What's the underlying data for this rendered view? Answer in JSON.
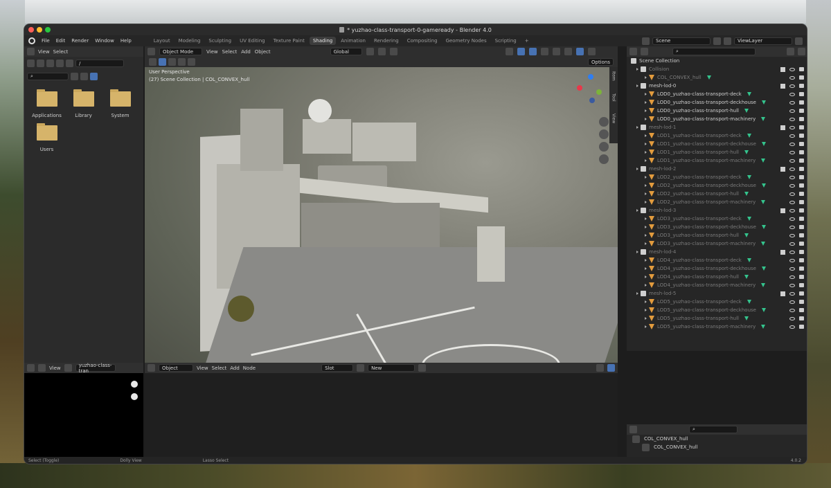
{
  "window": {
    "title": "* yuzhao-class-transport-0-gameready - Blender 4.0"
  },
  "menu": {
    "items": [
      "File",
      "Edit",
      "Render",
      "Window",
      "Help"
    ]
  },
  "workspace_tabs": [
    "Layout",
    "Modeling",
    "Sculpting",
    "UV Editing",
    "Texture Paint",
    "Shading",
    "Animation",
    "Rendering",
    "Compositing",
    "Geometry Nodes",
    "Scripting"
  ],
  "active_tab": "Shading",
  "scene": {
    "label": "Scene",
    "view_layer": "ViewLayer"
  },
  "file_browser": {
    "menu": [
      "View",
      "Select"
    ],
    "path": "/",
    "folders": [
      "Applications",
      "Library",
      "System",
      "Users"
    ]
  },
  "viewport": {
    "mode": "Object Mode",
    "menu": [
      "View",
      "Select",
      "Add",
      "Object"
    ],
    "transform": "Global",
    "options": "Options",
    "perspective": "User Perspective",
    "context": "(27) Scene Collection | COL_CONVEX_hull",
    "side_tabs": [
      "Item",
      "Tool",
      "View"
    ]
  },
  "outliner": {
    "root": "Scene Collection",
    "rows": [
      {
        "label": "Collision",
        "type": "coll",
        "level": 1,
        "dim": true
      },
      {
        "label": "COL_CONVEX_hull",
        "type": "mesh",
        "level": 2,
        "dim": true
      },
      {
        "label": "mesh-lod-0",
        "type": "coll",
        "level": 1,
        "dim": false
      },
      {
        "label": "LOD0_yuzhao-class-transport-deck",
        "type": "mesh",
        "level": 2,
        "dim": false
      },
      {
        "label": "LOD0_yuzhao-class-transport-deckhouse",
        "type": "mesh",
        "level": 2,
        "dim": false
      },
      {
        "label": "LOD0_yuzhao-class-transport-hull",
        "type": "mesh",
        "level": 2,
        "dim": false
      },
      {
        "label": "LOD0_yuzhao-class-transport-machinery",
        "type": "mesh",
        "level": 2,
        "dim": false
      },
      {
        "label": "mesh-lod-1",
        "type": "coll",
        "level": 1,
        "dim": true
      },
      {
        "label": "LOD1_yuzhao-class-transport-deck",
        "type": "mesh",
        "level": 2,
        "dim": true
      },
      {
        "label": "LOD1_yuzhao-class-transport-deckhouse",
        "type": "mesh",
        "level": 2,
        "dim": true
      },
      {
        "label": "LOD1_yuzhao-class-transport-hull",
        "type": "mesh",
        "level": 2,
        "dim": true
      },
      {
        "label": "LOD1_yuzhao-class-transport-machinery",
        "type": "mesh",
        "level": 2,
        "dim": true
      },
      {
        "label": "mesh-lod-2",
        "type": "coll",
        "level": 1,
        "dim": true
      },
      {
        "label": "LOD2_yuzhao-class-transport-deck",
        "type": "mesh",
        "level": 2,
        "dim": true
      },
      {
        "label": "LOD2_yuzhao-class-transport-deckhouse",
        "type": "mesh",
        "level": 2,
        "dim": true
      },
      {
        "label": "LOD2_yuzhao-class-transport-hull",
        "type": "mesh",
        "level": 2,
        "dim": true
      },
      {
        "label": "LOD2_yuzhao-class-transport-machinery",
        "type": "mesh",
        "level": 2,
        "dim": true
      },
      {
        "label": "mesh-lod-3",
        "type": "coll",
        "level": 1,
        "dim": true
      },
      {
        "label": "LOD3_yuzhao-class-transport-deck",
        "type": "mesh",
        "level": 2,
        "dim": true
      },
      {
        "label": "LOD3_yuzhao-class-transport-deckhouse",
        "type": "mesh",
        "level": 2,
        "dim": true
      },
      {
        "label": "LOD3_yuzhao-class-transport-hull",
        "type": "mesh",
        "level": 2,
        "dim": true
      },
      {
        "label": "LOD3_yuzhao-class-transport-machinery",
        "type": "mesh",
        "level": 2,
        "dim": true
      },
      {
        "label": "mesh-lod-4",
        "type": "coll",
        "level": 1,
        "dim": true
      },
      {
        "label": "LOD4_yuzhao-class-transport-deck",
        "type": "mesh",
        "level": 2,
        "dim": true
      },
      {
        "label": "LOD4_yuzhao-class-transport-deckhouse",
        "type": "mesh",
        "level": 2,
        "dim": true
      },
      {
        "label": "LOD4_yuzhao-class-transport-hull",
        "type": "mesh",
        "level": 2,
        "dim": true
      },
      {
        "label": "LOD4_yuzhao-class-transport-machinery",
        "type": "mesh",
        "level": 2,
        "dim": true
      },
      {
        "label": "mesh-lod-5",
        "type": "coll",
        "level": 1,
        "dim": true
      },
      {
        "label": "LOD5_yuzhao-class-transport-deck",
        "type": "mesh",
        "level": 2,
        "dim": true
      },
      {
        "label": "LOD5_yuzhao-class-transport-deckhouse",
        "type": "mesh",
        "level": 2,
        "dim": true
      },
      {
        "label": "LOD5_yuzhao-class-transport-hull",
        "type": "mesh",
        "level": 2,
        "dim": true
      },
      {
        "label": "LOD5_yuzhao-class-transport-machinery",
        "type": "mesh",
        "level": 2,
        "dim": true
      }
    ]
  },
  "properties": {
    "object": "COL_CONVEX_hull",
    "sub": "COL_CONVEX_hull"
  },
  "image_editor": {
    "menu": "View",
    "image_name": "yuzhao-class-tran"
  },
  "node_editor": {
    "type": "Object",
    "menu": [
      "View",
      "Select",
      "Add",
      "Node"
    ],
    "slot": "Slot",
    "new": "New"
  },
  "status": {
    "select": "Select (Toggle)",
    "dolly": "Dolly View",
    "lasso": "Lasso Select",
    "version": "4.0.2"
  }
}
